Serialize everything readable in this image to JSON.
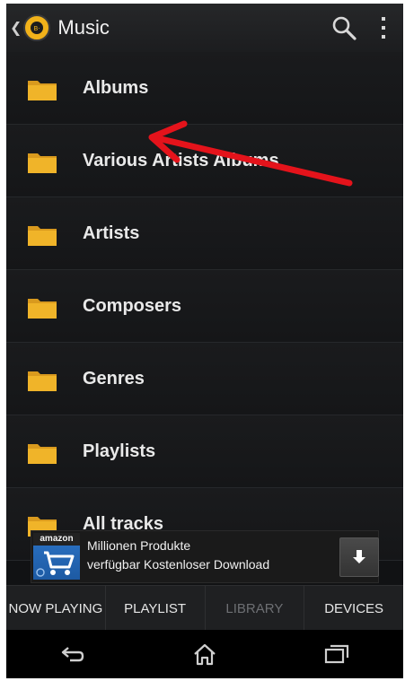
{
  "header": {
    "title": "Music",
    "back_icon": "chevron-left-icon",
    "logo_icon": "music-logo-icon",
    "actions": [
      {
        "name": "search",
        "icon": "search-icon"
      },
      {
        "name": "overflow-menu",
        "icon": "more-vertical-icon"
      }
    ]
  },
  "library": {
    "items": [
      {
        "label": "Albums",
        "icon": "folder-icon"
      },
      {
        "label": "Various Artists Albums",
        "icon": "folder-icon"
      },
      {
        "label": "Artists",
        "icon": "folder-icon"
      },
      {
        "label": "Composers",
        "icon": "folder-icon"
      },
      {
        "label": "Genres",
        "icon": "folder-icon"
      },
      {
        "label": "Playlists",
        "icon": "folder-icon"
      },
      {
        "label": "All tracks",
        "icon": "folder-icon"
      }
    ]
  },
  "annotation": {
    "icon": "red-arrow-icon",
    "color": "#e4131b"
  },
  "ad": {
    "brand": "amazon",
    "line1": "Millionen Produkte",
    "line2": "verfügbar Kostenloser Download",
    "download_icon": "download-icon"
  },
  "tabs": [
    {
      "label": "NOW PLAYING",
      "active": false
    },
    {
      "label": "PLAYLIST",
      "active": false
    },
    {
      "label": "LIBRARY",
      "active": true
    },
    {
      "label": "DEVICES",
      "active": false
    }
  ],
  "nav": [
    {
      "name": "back",
      "icon": "back-icon"
    },
    {
      "name": "home",
      "icon": "home-icon"
    },
    {
      "name": "recents",
      "icon": "recents-icon"
    }
  ],
  "colors": {
    "folder": "#f0b429",
    "accent": "#f1b21a",
    "background": "#151618"
  }
}
